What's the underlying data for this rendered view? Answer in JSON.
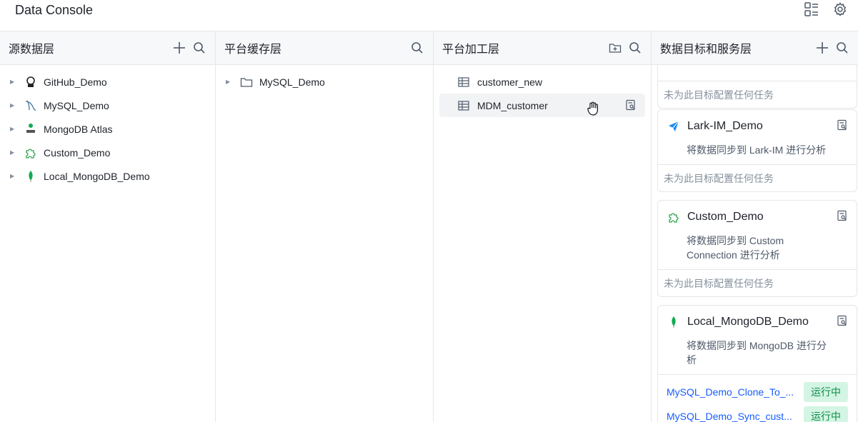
{
  "app": {
    "title": "Data Console"
  },
  "columns": {
    "source": {
      "title": "源数据层",
      "items": [
        {
          "label": "GitHub_Demo",
          "icon": "github-icon"
        },
        {
          "label": "MySQL_Demo",
          "icon": "mysql-dolphin-icon"
        },
        {
          "label": "MongoDB Atlas",
          "icon": "atlas-icon"
        },
        {
          "label": "Custom_Demo",
          "icon": "puzzle-icon"
        },
        {
          "label": "Local_MongoDB_Demo",
          "icon": "mongodb-leaf-icon"
        }
      ]
    },
    "cache": {
      "title": "平台缓存层",
      "items": [
        {
          "label": "MySQL_Demo",
          "icon": "folder-icon"
        }
      ]
    },
    "processing": {
      "title": "平台加工层",
      "items": [
        {
          "label": "customer_new",
          "icon": "table-icon"
        },
        {
          "label": "MDM_customer",
          "icon": "table-icon"
        }
      ]
    },
    "targets": {
      "title": "数据目标和服务层",
      "cards": [
        {
          "name": "",
          "desc": "",
          "empty": "未为此目标配置任何任务"
        },
        {
          "name": "Lark-IM_Demo",
          "icon": "lark-icon",
          "desc": "将数据同步到 Lark-IM 进行分析",
          "empty": "未为此目标配置任何任务"
        },
        {
          "name": "Custom_Demo",
          "icon": "puzzle-icon",
          "desc": "将数据同步到 Custom Connection 进行分析",
          "empty": "未为此目标配置任何任务"
        },
        {
          "name": "Local_MongoDB_Demo",
          "icon": "mongodb-leaf-icon",
          "desc": "将数据同步到 MongoDB 进行分析",
          "tasks": [
            {
              "label": "MySQL_Demo_Clone_To_...",
              "status": "运行中"
            },
            {
              "label": "MySQL_Demo_Sync_cust...",
              "status": "运行中"
            }
          ]
        }
      ]
    }
  },
  "colors": {
    "accent": "#165dff",
    "running_bg": "#d4f5e3",
    "running_text": "#0e8a4b",
    "border": "#e5e6eb"
  }
}
